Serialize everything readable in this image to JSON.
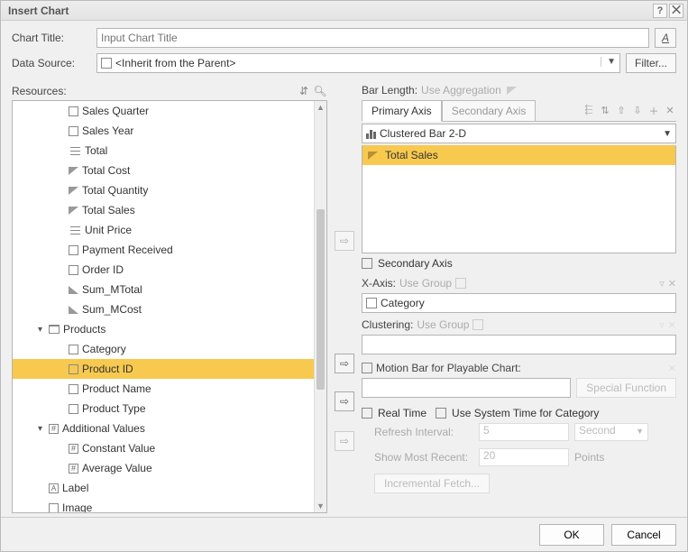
{
  "titlebar": {
    "title": "Insert Chart"
  },
  "form": {
    "chart_title_label": "Chart Title:",
    "chart_title_placeholder": "Input Chart Title",
    "data_source_label": "Data Source:",
    "data_source_value": "<Inherit from the Parent>",
    "filter_label": "Filter..."
  },
  "resources_label": "Resources:",
  "tree": [
    {
      "level": 2,
      "icon": "box",
      "label": "Sales Quarter"
    },
    {
      "level": 2,
      "icon": "box",
      "label": "Sales Year"
    },
    {
      "level": 2,
      "icon": "lines",
      "label": "Total"
    },
    {
      "level": 2,
      "icon": "tri",
      "label": "Total Cost"
    },
    {
      "level": 2,
      "icon": "tri",
      "label": "Total Quantity"
    },
    {
      "level": 2,
      "icon": "tri",
      "label": "Total Sales"
    },
    {
      "level": 2,
      "icon": "lines",
      "label": "Unit Price"
    },
    {
      "level": 2,
      "icon": "box",
      "label": "Payment Received"
    },
    {
      "level": 2,
      "icon": "box",
      "label": "Order ID"
    },
    {
      "level": 2,
      "icon": "tri2",
      "label": "Sum_MTotal"
    },
    {
      "level": 2,
      "icon": "tri2",
      "label": "Sum_MCost"
    },
    {
      "level": 1,
      "icon": "folder",
      "label": "Products",
      "expanded": true
    },
    {
      "level": 2,
      "icon": "box",
      "label": "Category"
    },
    {
      "level": 2,
      "icon": "box",
      "label": "Product ID",
      "selected": true
    },
    {
      "level": 2,
      "icon": "box",
      "label": "Product Name"
    },
    {
      "level": 2,
      "icon": "box",
      "label": "Product Type"
    },
    {
      "level": 1,
      "icon": "hash",
      "label": "Additional Values",
      "expanded": true
    },
    {
      "level": 2,
      "icon": "hash",
      "label": "Constant Value"
    },
    {
      "level": 2,
      "icon": "hash",
      "label": "Average Value"
    },
    {
      "level": 1,
      "icon": "A",
      "label": "Label",
      "leaf": true
    },
    {
      "level": 1,
      "icon": "box",
      "label": "Image",
      "leaf": true
    }
  ],
  "right": {
    "bar_length_label": "Bar Length:",
    "bar_length_hint": "Use Aggregation",
    "tabs": {
      "primary": "Primary Axis",
      "secondary": "Secondary Axis"
    },
    "chart_type": "Clustered Bar 2-D",
    "series": [
      "Total Sales"
    ],
    "secondary_axis_label": "Secondary Axis",
    "x_axis_label": "X-Axis:",
    "x_axis_hint": "Use Group",
    "x_axis_value": "Category",
    "clustering_label": "Clustering:",
    "clustering_hint": "Use Group",
    "motion_bar_label": "Motion Bar for Playable Chart:",
    "special_function_label": "Special Function",
    "realtime_label": "Real Time",
    "use_system_time_label": "Use System Time for Category",
    "refresh_interval_label": "Refresh Interval:",
    "refresh_interval_value": "5",
    "refresh_unit": "Second",
    "show_recent_label": "Show Most Recent:",
    "show_recent_value": "20",
    "points_label": "Points",
    "incremental_fetch_label": "Incremental Fetch..."
  },
  "footer": {
    "ok": "OK",
    "cancel": "Cancel"
  }
}
